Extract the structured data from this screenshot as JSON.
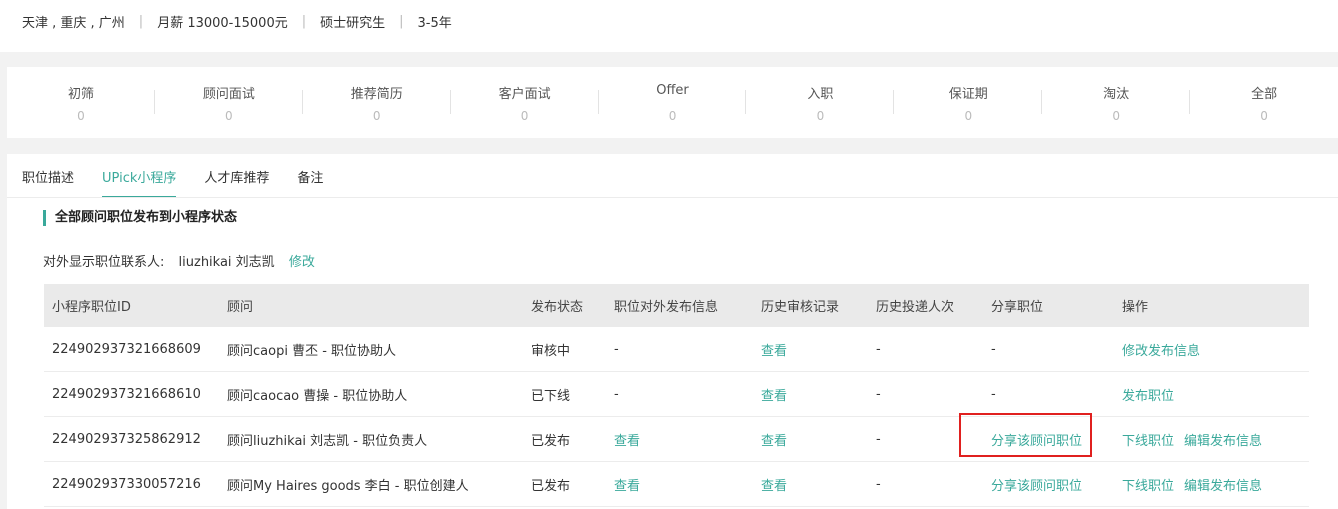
{
  "job_meta": {
    "cities": "天津 , 重庆 , 广州",
    "salary": "月薪 13000-15000元",
    "education": "硕士研究生",
    "experience": "3-5年"
  },
  "pipeline": [
    {
      "label": "初筛",
      "count": "0"
    },
    {
      "label": "顾问面试",
      "count": "0"
    },
    {
      "label": "推荐简历",
      "count": "0"
    },
    {
      "label": "客户面试",
      "count": "0"
    },
    {
      "label": "Offer",
      "count": "0"
    },
    {
      "label": "入职",
      "count": "0"
    },
    {
      "label": "保证期",
      "count": "0"
    },
    {
      "label": "淘汰",
      "count": "0"
    },
    {
      "label": "全部",
      "count": "0"
    }
  ],
  "tabs": [
    {
      "label": "职位描述",
      "active": false
    },
    {
      "label": "UPick小程序",
      "active": true
    },
    {
      "label": "人才库推荐",
      "active": false
    },
    {
      "label": "备注",
      "active": false
    }
  ],
  "section": {
    "title": "全部顾问职位发布到小程序状态",
    "contact_label": "对外显示职位联系人:",
    "contact_name": "liuzhikai 刘志凯",
    "contact_edit": "修改"
  },
  "table": {
    "headers": [
      "小程序职位ID",
      "顾问",
      "发布状态",
      "职位对外发布信息",
      "历史审核记录",
      "历史投递人次",
      "分享职位",
      "操作"
    ],
    "rows": [
      {
        "id": "224902937321668609",
        "consultant": "顾问caopi 曹丕 - 职位协助人",
        "status": "审核中",
        "publish_info": "-",
        "publish_info_link": false,
        "history": "查看",
        "deliveries": "-",
        "share": "-",
        "share_link": false,
        "actions": [
          "修改发布信息"
        ]
      },
      {
        "id": "224902937321668610",
        "consultant": "顾问caocao 曹操 - 职位协助人",
        "status": "已下线",
        "publish_info": "-",
        "publish_info_link": false,
        "history": "查看",
        "deliveries": "-",
        "share": "-",
        "share_link": false,
        "actions": [
          "发布职位"
        ]
      },
      {
        "id": "224902937325862912",
        "consultant": "顾问liuzhikai 刘志凯 - 职位负责人",
        "status": "已发布",
        "publish_info": "查看",
        "publish_info_link": true,
        "history": "查看",
        "deliveries": "-",
        "share": "分享该顾问职位",
        "share_link": true,
        "actions": [
          "下线职位",
          "编辑发布信息"
        ]
      },
      {
        "id": "224902937330057216",
        "consultant": "顾问My Haires goods 李白 - 职位创建人",
        "status": "已发布",
        "publish_info": "查看",
        "publish_info_link": true,
        "history": "查看",
        "deliveries": "-",
        "share": "分享该顾问职位",
        "share_link": true,
        "actions": [
          "下线职位",
          "编辑发布信息"
        ]
      }
    ]
  },
  "colors": {
    "accent": "#3aa99b",
    "highlight_border": "#e0201f"
  }
}
